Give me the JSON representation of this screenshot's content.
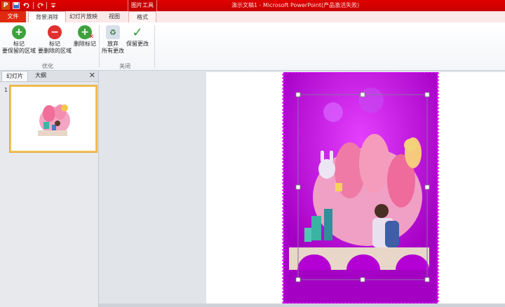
{
  "qat": {
    "app_icon_label": "P",
    "icons": [
      "powerpoint-icon",
      "save-icon",
      "undo-icon",
      "redo-icon",
      "customize-icon"
    ]
  },
  "title": {
    "text": "演示文稿1 - Microsoft PowerPoint(产品激活失败)",
    "context_header": "图片工具"
  },
  "tabs": {
    "file": "文件",
    "background_removal": "背景消除",
    "slideshow": "幻灯片放映",
    "view": "视图",
    "format": "格式"
  },
  "ribbon": {
    "optimize_group": "优化",
    "close_group": "关闭",
    "mark_keep": {
      "line1": "标记",
      "line2": "要保留的区域"
    },
    "mark_remove": {
      "line1": "标记",
      "line2": "要删除的区域"
    },
    "delete_mark": {
      "line1": "删除标记"
    },
    "discard": {
      "line1": "放弃",
      "line2": "所有更改"
    },
    "keep_changes": {
      "line1": "保留更改"
    }
  },
  "panel": {
    "slides_tab": "幻灯片",
    "outline_tab": "大纲",
    "close_glyph": "✕",
    "slide_number": "1"
  },
  "colors": {
    "title_bar": "#d40000",
    "removal_overlay": "#b400d4",
    "thumb_border": "#f1c35a"
  }
}
